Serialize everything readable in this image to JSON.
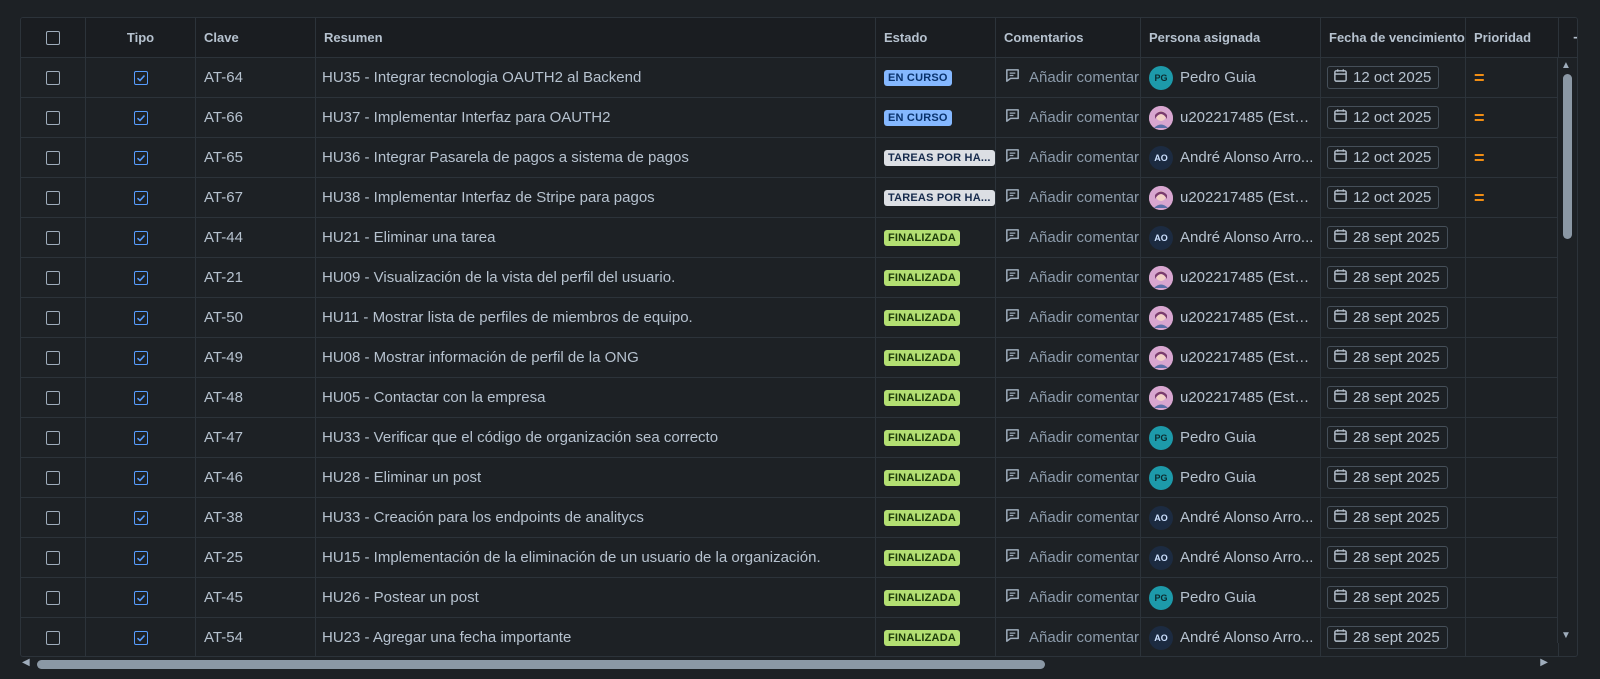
{
  "columns": {
    "tipo": "Tipo",
    "clave": "Clave",
    "resumen": "Resumen",
    "estado": "Estado",
    "comentarios": "Comentarios",
    "persona": "Persona asignada",
    "fecha": "Fecha de vencimiento",
    "prioridad": "Prioridad",
    "add": "+"
  },
  "comment_placeholder": "Añadir comentari",
  "colors": {
    "en_curso": "#85b8ff",
    "tareas": "#dcdfe4",
    "finalizada": "#b3df72",
    "priority_medium": "#f18d13"
  },
  "rows": [
    {
      "clave": "AT-64",
      "resumen": "HU35 - Integrar tecnologia OAUTH2 al Backend",
      "estado": "EN CURSO",
      "estado_kind": "curso",
      "avatar": "PG",
      "avatar_kind": "pg",
      "persona": "Pedro Guia",
      "fecha": "12 oct 2025",
      "prioridad": "="
    },
    {
      "clave": "AT-66",
      "resumen": "HU37 - Implementar Interfaz para OAUTH2",
      "estado": "EN CURSO",
      "estado_kind": "curso",
      "avatar": "",
      "avatar_kind": "img",
      "persona": "u202217485 (Este...",
      "fecha": "12 oct 2025",
      "prioridad": "="
    },
    {
      "clave": "AT-65",
      "resumen": "HU36 - Integrar Pasarela de pagos a sistema de pagos",
      "estado": "TAREAS POR HA...",
      "estado_kind": "tareas",
      "avatar": "AO",
      "avatar_kind": "ao",
      "persona": "André Alonso Arro...",
      "fecha": "12 oct 2025",
      "prioridad": "="
    },
    {
      "clave": "AT-67",
      "resumen": "HU38 - Implementar Interfaz de Stripe para pagos",
      "estado": "TAREAS POR HA...",
      "estado_kind": "tareas",
      "avatar": "",
      "avatar_kind": "img",
      "persona": "u202217485 (Este...",
      "fecha": "12 oct 2025",
      "prioridad": "="
    },
    {
      "clave": "AT-44",
      "resumen": "HU21 - Eliminar una tarea",
      "estado": "FINALIZADA",
      "estado_kind": "fin",
      "avatar": "AO",
      "avatar_kind": "ao",
      "persona": "André Alonso Arro...",
      "fecha": "28 sept 2025",
      "prioridad": ""
    },
    {
      "clave": "AT-21",
      "resumen": "HU09 - Visualización de la vista del perfil del usuario.",
      "estado": "FINALIZADA",
      "estado_kind": "fin",
      "avatar": "",
      "avatar_kind": "img",
      "persona": "u202217485 (Este...",
      "fecha": "28 sept 2025",
      "prioridad": ""
    },
    {
      "clave": "AT-50",
      "resumen": "HU11 - Mostrar lista de perfiles de miembros de equipo.",
      "estado": "FINALIZADA",
      "estado_kind": "fin",
      "avatar": "",
      "avatar_kind": "img",
      "persona": "u202217485 (Este...",
      "fecha": "28 sept 2025",
      "prioridad": ""
    },
    {
      "clave": "AT-49",
      "resumen": "HU08 - Mostrar información de perfil de la ONG",
      "estado": "FINALIZADA",
      "estado_kind": "fin",
      "avatar": "",
      "avatar_kind": "img",
      "persona": "u202217485 (Este...",
      "fecha": "28 sept 2025",
      "prioridad": ""
    },
    {
      "clave": "AT-48",
      "resumen": "HU05 - Contactar con la empresa",
      "estado": "FINALIZADA",
      "estado_kind": "fin",
      "avatar": "",
      "avatar_kind": "img",
      "persona": "u202217485 (Este...",
      "fecha": "28 sept 2025",
      "prioridad": ""
    },
    {
      "clave": "AT-47",
      "resumen": "HU33 - Verificar que el código de organización sea correcto",
      "estado": "FINALIZADA",
      "estado_kind": "fin",
      "avatar": "PG",
      "avatar_kind": "pg",
      "persona": "Pedro Guia",
      "fecha": "28 sept 2025",
      "prioridad": ""
    },
    {
      "clave": "AT-46",
      "resumen": "HU28 - Eliminar un post",
      "estado": "FINALIZADA",
      "estado_kind": "fin",
      "avatar": "PG",
      "avatar_kind": "pg",
      "persona": "Pedro Guia",
      "fecha": "28 sept 2025",
      "prioridad": ""
    },
    {
      "clave": "AT-38",
      "resumen": "HU33 - Creación para los endpoints de analitycs",
      "estado": "FINALIZADA",
      "estado_kind": "fin",
      "avatar": "AO",
      "avatar_kind": "ao",
      "persona": "André Alonso Arro...",
      "fecha": "28 sept 2025",
      "prioridad": ""
    },
    {
      "clave": "AT-25",
      "resumen": "HU15 - Implementación de la eliminación de un usuario de la organización.",
      "estado": "FINALIZADA",
      "estado_kind": "fin",
      "avatar": "AO",
      "avatar_kind": "ao",
      "persona": "André Alonso Arro...",
      "fecha": "28 sept 2025",
      "prioridad": ""
    },
    {
      "clave": "AT-45",
      "resumen": "HU26 - Postear un post",
      "estado": "FINALIZADA",
      "estado_kind": "fin",
      "avatar": "PG",
      "avatar_kind": "pg",
      "persona": "Pedro Guia",
      "fecha": "28 sept 2025",
      "prioridad": ""
    },
    {
      "clave": "AT-54",
      "resumen": "HU23 - Agregar una fecha importante",
      "estado": "FINALIZADA",
      "estado_kind": "fin",
      "avatar": "AO",
      "avatar_kind": "ao",
      "persona": "André Alonso Arro...",
      "fecha": "28 sept 2025",
      "prioridad": ""
    }
  ]
}
